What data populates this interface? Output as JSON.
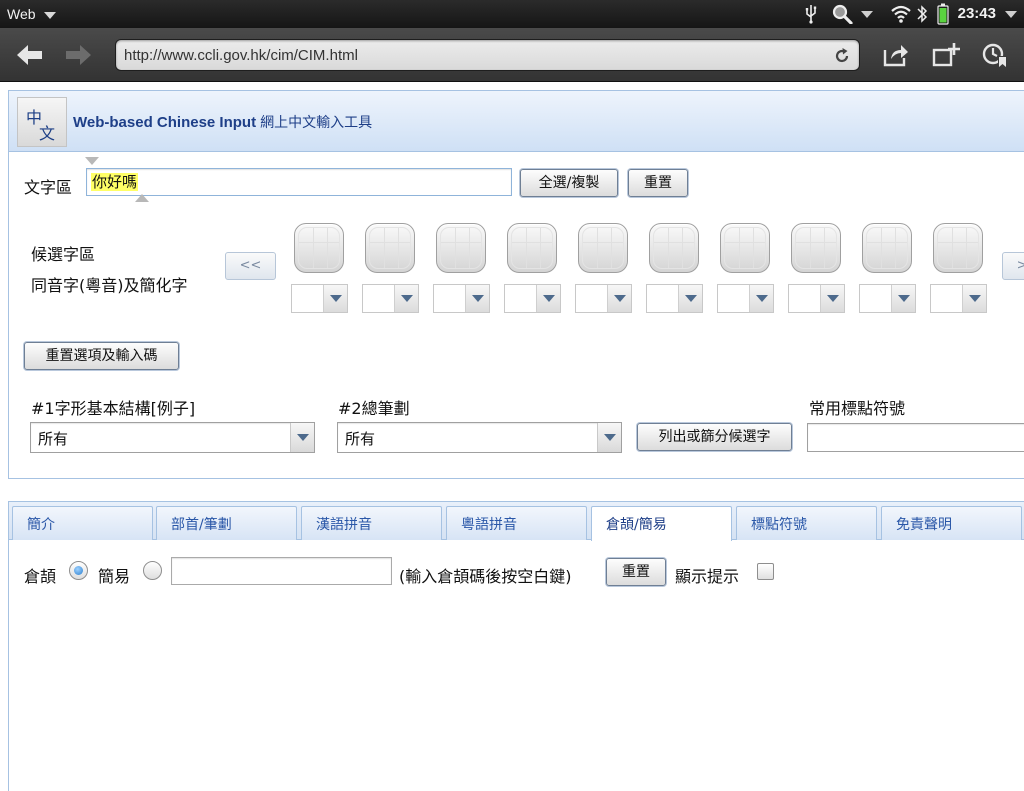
{
  "statusbar": {
    "app_name": "Web",
    "time": "23:43"
  },
  "browser": {
    "url": "http://www.ccli.gov.hk/cim/CIM.html"
  },
  "header": {
    "logo_char_1": "中",
    "logo_char_2": "文",
    "title_en": "Web-based Chinese Input",
    "title_zh": "網上中文輸入工具"
  },
  "text_area": {
    "label": "文字區",
    "value": "你好嗎",
    "select_copy_label": "全選/複製",
    "reset_label": "重置"
  },
  "candidates": {
    "label_1": "候選字區",
    "label_2": "同音字(粵音)及簡化字",
    "prev_label": "<<",
    "next_label": ">>",
    "reset_options_label": "重置選項及輸入碼"
  },
  "filters": {
    "structure_label": "#1字形基本結構[例子]",
    "structure_value": "所有",
    "strokes_label": "#2總筆劃",
    "strokes_value": "所有",
    "list_button_label": "列出或篩分候選字",
    "punct_label": "常用標點符號"
  },
  "tabs": [
    {
      "label": "簡介"
    },
    {
      "label": "部首/筆劃"
    },
    {
      "label": "漢語拼音"
    },
    {
      "label": "粵語拼音"
    },
    {
      "label": "倉頡/簡易"
    },
    {
      "label": "標點符號"
    },
    {
      "label": "免責聲明"
    }
  ],
  "active_tab": "倉頡/簡易",
  "cangjie": {
    "radio_1_label": "倉頡",
    "radio_2_label": "簡易",
    "input_value": "",
    "hint_text": "(輸入倉頡碼後按空白鍵)",
    "reset_label": "重置",
    "show_hint_label": "顯示提示"
  }
}
